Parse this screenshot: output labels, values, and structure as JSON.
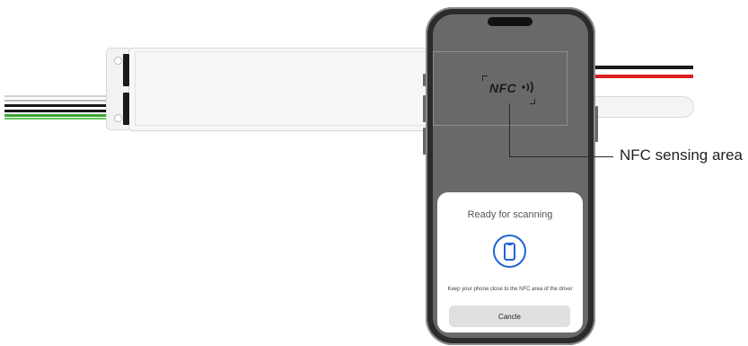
{
  "nfc": {
    "logo_text": "NFC",
    "callout_label": "NFC sensing area"
  },
  "dialog": {
    "title": "Ready for scanning",
    "message": "Keep your phone close to the NFC area of the driver",
    "cancel_label": "Cancle"
  },
  "icons": {
    "nfc_waves": "nfc-wave-icon",
    "scan_phone": "smartphone-icon"
  },
  "colors": {
    "accent": "#1e64d6",
    "wire_black": "#1a1a1a",
    "wire_red": "#e02020",
    "wire_green": "#3aa635",
    "wire_white": "#e8e8e8"
  }
}
